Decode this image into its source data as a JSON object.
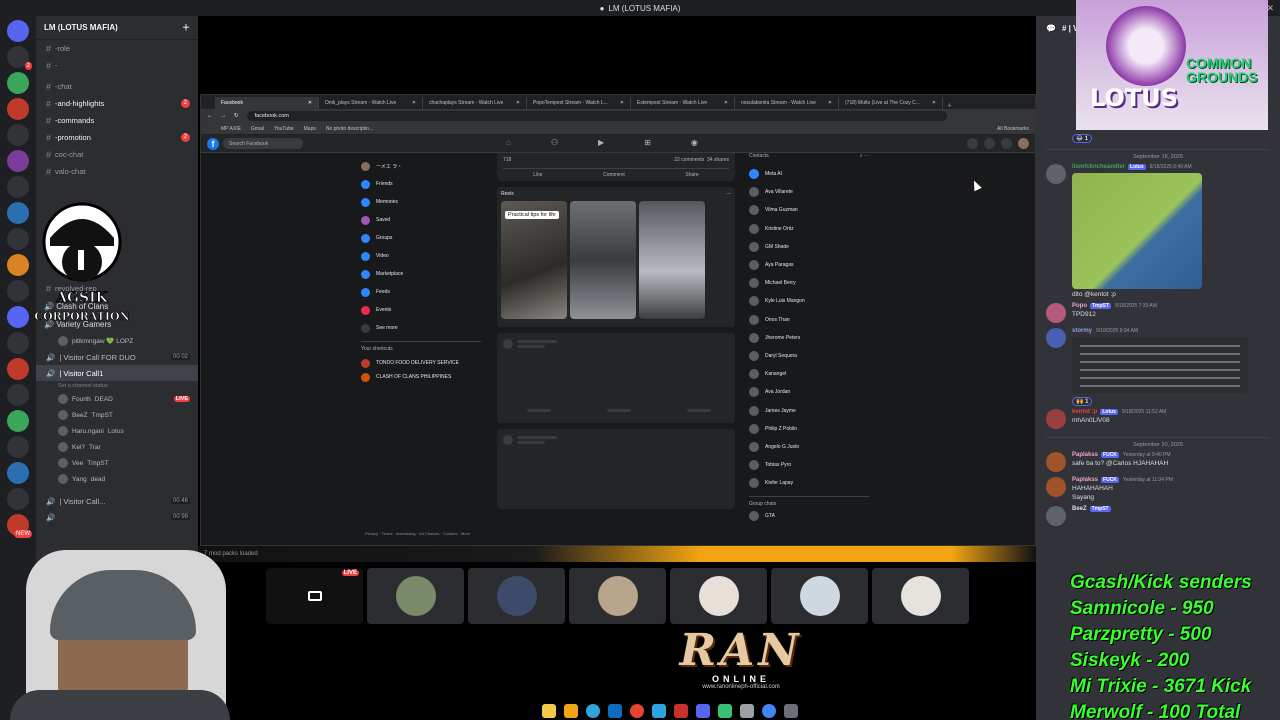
{
  "window": {
    "title": "LM (LOTUS MAFIA)"
  },
  "server": {
    "name": "LM (LOTUS MAFIA)",
    "channels": [
      {
        "label": "-role",
        "bright": false
      },
      {
        "label": "-",
        "bright": false
      },
      {
        "label": "-chat",
        "bright": false
      },
      {
        "label": "-and-highlights",
        "bright": true,
        "badge": "2"
      },
      {
        "label": "-commands",
        "bright": true
      },
      {
        "label": "-promotion",
        "bright": true,
        "badge": "2"
      },
      {
        "label": "coc-chat",
        "bright": false
      },
      {
        "label": "valo-chat",
        "bright": false
      }
    ],
    "resolved_rep": "revolved-rep",
    "categories": [
      "Clash of Clans",
      "Variety Gamers"
    ],
    "voice_channels": [
      {
        "label": "pitikmngaw 💚 LOPZ",
        "kind": "user"
      },
      {
        "label": "| Visitor Call FOR DUO",
        "kind": "voice",
        "count": "00 02"
      },
      {
        "label": "| Visitor Call1",
        "kind": "voice-active"
      },
      {
        "label": "Set a channel status",
        "kind": "status"
      }
    ],
    "voice_users": [
      {
        "name": "Fourth",
        "tag": "DEAD",
        "live": "LIVE"
      },
      {
        "name": "BeeZ",
        "tag": "TmpST"
      },
      {
        "name": "Haru.ngani",
        "tag": "Lotus"
      },
      {
        "name": "Kei?",
        "tag": "Trar"
      },
      {
        "name": "Vee",
        "tag": "TmpST"
      },
      {
        "name": "Yang",
        "tag": "dead"
      }
    ],
    "more_voice": [
      {
        "label": "| Visitor Call...",
        "count": "00 46"
      },
      {
        "label": "",
        "count": "00 99"
      }
    ],
    "logo_text": "AGSIK CORPORATION"
  },
  "browser": {
    "tabs": [
      {
        "label": "Facebook",
        "active": true
      },
      {
        "label": "Onik_plays Stream - Watch Live",
        "active": false
      },
      {
        "label": "chachaplays Stream - Watch Live",
        "active": false
      },
      {
        "label": "PopoTempest Stream - Watch L...",
        "active": false
      },
      {
        "label": "Estempest Stream - Watch Live",
        "active": false
      },
      {
        "label": "nosulabonita Stream - Watch Live",
        "active": false
      },
      {
        "label": "(718) Multo (Live at The Cozy C...",
        "active": false
      }
    ],
    "url": "facebook.com",
    "bookmarks": [
      "MP AXIE",
      "Gmail",
      "YouTube",
      "Maps",
      "No photo descriptio..."
    ],
    "all_bookmarks": "All Bookmarks"
  },
  "facebook": {
    "search_placeholder": "Search Facebook",
    "profile_name": "ーメエ ラ・",
    "left_nav": [
      "Friends",
      "Memories",
      "Saved",
      "Groups",
      "Video",
      "Marketplace",
      "Feeds",
      "Events",
      "See more"
    ],
    "shortcuts_title": "Your shortcuts",
    "shortcuts": [
      "TONDO FOOD DELIVERY SERVICE",
      "CLASH OF CLANS PHILIPPINES"
    ],
    "post_reacts": "718",
    "post_comments": "22 comments",
    "post_shares": "34 shares",
    "post_actions": [
      "Like",
      "Comment",
      "Share"
    ],
    "reels_title": "Reels",
    "reel_caption": "Practical tips for life",
    "contacts_title": "Contacts",
    "contacts": [
      "Meta AI",
      "Ava Villarete",
      "Vilma Guzman",
      "Kristine Ortiz",
      "GM Shade",
      "Aya Paragas",
      "Michael Berry",
      "Kyle Luis Mangon",
      "Onos Than",
      "Jherome Peters",
      "Daryl Sequera",
      "Kanangel",
      "Ava Jordan",
      "James Jayme",
      "Philip Z Pobilo",
      "Angelo G Justo",
      "Tobias Pyro",
      "Kiefer Lapay"
    ],
    "group_chats_title": "Group chats",
    "group_chat": "GTA",
    "footer": "Privacy · Terms · Advertising · Ad Choices · Cookies · More"
  },
  "stream": {
    "status": "7 mod packs loaded",
    "live_label": "LIVE"
  },
  "ran": {
    "title": "RAN",
    "subtitle": "ONLINE",
    "url": "www.ranonlineph-official.com"
  },
  "chat": {
    "channel": "# | Visi...",
    "reaction1": "1",
    "date1": "September 18, 2025",
    "messages": [
      {
        "name": "itsmfckncheandler",
        "tag": "Lotus",
        "time": "9/18/2025 6:49 AM",
        "text": "dito @kentot :p",
        "color": "#3ba55c",
        "has_map": true
      },
      {
        "name": "Popo",
        "tag": "TmpST",
        "time": "9/18/2025 7:33 AM",
        "text": "TPD912",
        "color": "#f0a3c4"
      },
      {
        "name": "stormy",
        "tag": "",
        "time": "9/18/2025 9:34 AM",
        "text": "",
        "color": "#5865f2",
        "has_table": true
      },
      {
        "name": "kentot :p",
        "tag": "Lotus",
        "time": "9/18/2025 11:52 AM",
        "text": "mhAn0LIV08",
        "color": "#f23f43"
      }
    ],
    "reaction2": "1",
    "date2": "September 20, 2025",
    "messages2": [
      {
        "name": "Paplakss",
        "tag": "FUCK",
        "time": "Yesterday at 9:40 PM",
        "text": "safe ba to? @Carlos HJAHAHAH",
        "color": "#f0a3c4"
      },
      {
        "name": "Paplakss",
        "tag": "FUCK",
        "time": "Yesterday at 11:34 PM",
        "text": "HAHAHAHAH",
        "color": "#f0a3c4"
      },
      {
        "name": "",
        "tag": "",
        "time": "",
        "text": "Sayang",
        "color": "#dbdee1"
      },
      {
        "name": "BeeZ",
        "tag": "TmpST",
        "time": "",
        "text": "",
        "color": "#dbdee1"
      }
    ],
    "lotus_logo": "LOTUS",
    "common_grounds": "COMMON GROUNDS"
  },
  "donations": {
    "title": "Gcash/Kick senders",
    "lines": [
      "Samnicole - 950",
      "Parzpretty - 500",
      "Siskeyk - 200",
      "Mi Trixie - 3671 Kick",
      "Merwolf - 100 Total"
    ]
  }
}
